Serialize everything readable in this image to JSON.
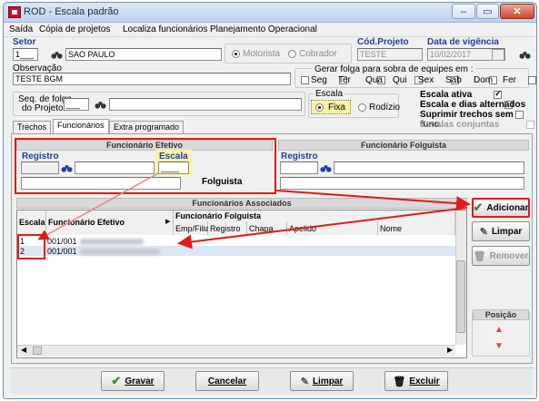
{
  "window": {
    "title": "ROD - Escala padrão"
  },
  "menu": [
    "Saída",
    "Cópia de projetos",
    "Localiza funcionários",
    "Planejamento Operacional"
  ],
  "form": {
    "setor_label": "Setor",
    "setor_code": "1___",
    "setor_name": "SAO PAULO",
    "motorista_label": "Motorista",
    "cobrador_label": "Cobrador",
    "cod_projeto_label": "Cód.Projeto",
    "cod_projeto_value": "TESTE",
    "data_vigencia_label": "Data de vigência",
    "data_vigencia_value": "10/02/2017",
    "observacao_label": "Observação",
    "observacao_value": "TESTE BGM",
    "gerar_folga_label": "Gerar folga para sobra de equipes em :",
    "dias": [
      "Seg",
      "Ter",
      "Qua",
      "Qui",
      "Sex",
      "Sab",
      "Dom",
      "Fer"
    ],
    "seq_folga_label_1": "Seq. de folga",
    "seq_folga_label_2": "do Projeto",
    "seq_folga_value": "___",
    "escala_group_label": "Escala",
    "fixa_label": "Fixa",
    "rodizio_label": "Rodízio",
    "opts": {
      "escala_ativa": "Escala ativa",
      "escala_dias_alternados": "Escala e dias alternados",
      "suprimir_trechos": "Suprimir trechos sem func.",
      "escalas_conjuntas": "Escalas conjuntas"
    }
  },
  "tabs": [
    "Trechos",
    "Funcionários",
    "Extra programado"
  ],
  "efetivo": {
    "header": "Funcionário Efetivo",
    "registro_label": "Registro",
    "escala_label": "Escala",
    "escala_value": "____",
    "folguista_label": "Folguista"
  },
  "folguista": {
    "header": "Funcionário Folguista",
    "registro_label": "Registro"
  },
  "associados": {
    "header": "Funcionários Associados",
    "col_escala": "Escala",
    "col_efetivo": "Funcionário Efetivo",
    "col_folguista": "Funcionário Folguista",
    "sub_cols": [
      "Emp/Filial",
      "Registro",
      "Chapa",
      "Apelido",
      "Nome"
    ],
    "rows": [
      {
        "escala": "1",
        "efetivo": "001/001"
      },
      {
        "escala": "2",
        "efetivo": "001/001"
      }
    ]
  },
  "side_buttons": {
    "adicionar": "Adicionar",
    "limpar": "Limpar",
    "remover": "Remover",
    "posicao": "Posição"
  },
  "bottom_buttons": {
    "gravar": "Gravar",
    "cancelar": "Cancelar",
    "limpar": "Limpar",
    "excluir": "Excluir"
  }
}
